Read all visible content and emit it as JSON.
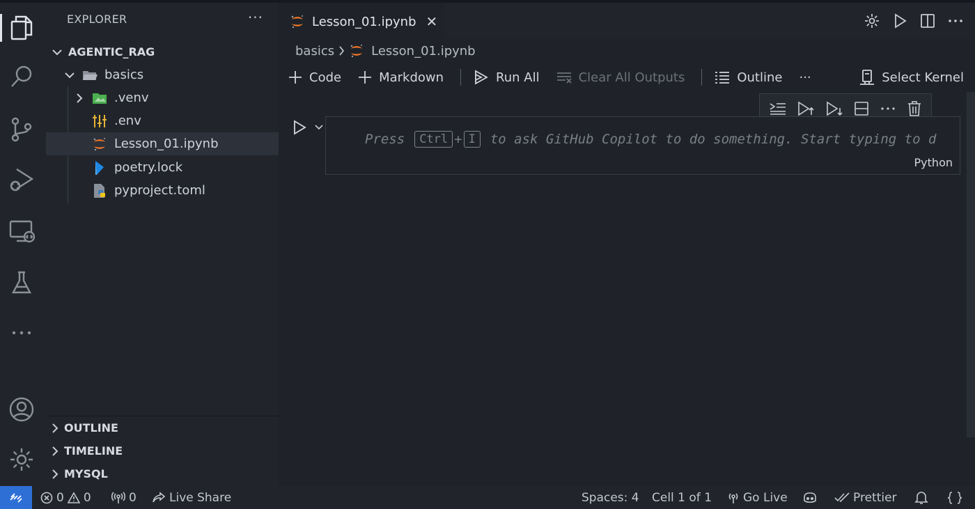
{
  "sidebar": {
    "title": "EXPLORER",
    "more": "···",
    "root": "AGENTIC_RAG",
    "folder": "basics",
    "items": [
      {
        "label": ".venv",
        "icon": "folder-venv-icon"
      },
      {
        "label": ".env",
        "icon": "env-settings-icon"
      },
      {
        "label": "Lesson_01.ipynb",
        "icon": "jupyter-icon"
      },
      {
        "label": "poetry.lock",
        "icon": "poetry-icon"
      },
      {
        "label": "pyproject.toml",
        "icon": "python-config-icon"
      }
    ],
    "sections": [
      "OUTLINE",
      "TIMELINE",
      "MYSQL"
    ]
  },
  "tab": {
    "label": "Lesson_01.ipynb",
    "close": "✕"
  },
  "breadcrumb": {
    "folder": "basics",
    "file": "Lesson_01.ipynb"
  },
  "toolbar": {
    "code": "Code",
    "markdown": "Markdown",
    "run_all": "Run All",
    "clear_outputs": "Clear All Outputs",
    "outline": "Outline",
    "more": "···",
    "select_kernel": "Select Kernel"
  },
  "cell": {
    "press": "Press",
    "key1": "Ctrl",
    "plus": "+",
    "key2": "I",
    "hint": "to ask GitHub Copilot to do something. Start typing to d",
    "language": "Python"
  },
  "status": {
    "errors": "0",
    "warnings": "0",
    "ports": "0",
    "live_share": "Live Share",
    "spaces": "Spaces: 4",
    "cell_pos": "Cell 1 of 1",
    "go_live": "Go Live",
    "prettier": "Prettier"
  },
  "colors": {
    "accent": "#2e6fd6",
    "jupyter_orange": "#f37726",
    "folder_green": "#4caf50"
  }
}
